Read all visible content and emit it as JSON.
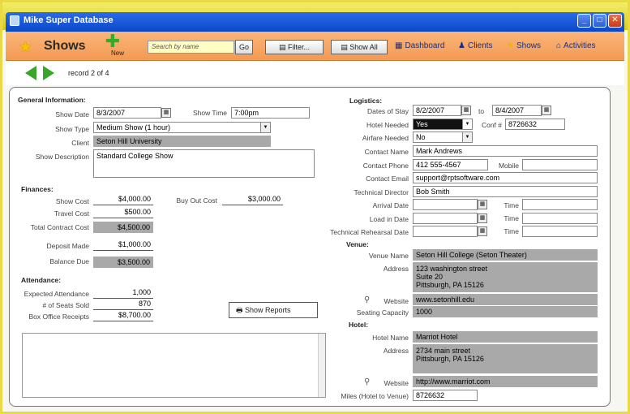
{
  "window": {
    "title": "Mike Super Database",
    "min": "_",
    "max": "□",
    "close": "✕"
  },
  "toolbar": {
    "title": "Shows",
    "new_label": "New",
    "search_placeholder": "Search by name",
    "go_label": "Go",
    "filter_label": "Filter...",
    "show_all_label": "Show All",
    "nav": [
      {
        "label": "Dashboard",
        "icon": "dashboard-icon"
      },
      {
        "label": "Clients",
        "icon": "clients-icon"
      },
      {
        "label": "Shows",
        "icon": "star-icon"
      },
      {
        "label": "Activities",
        "icon": "activities-icon"
      }
    ]
  },
  "record": {
    "text": "record 2 of 4"
  },
  "general": {
    "heading": "General Information:",
    "show_date_label": "Show Date",
    "show_date": "8/3/2007",
    "show_time_label": "Show Time",
    "show_time": "7:00pm",
    "show_type_label": "Show Type",
    "show_type": "Medium Show (1 hour)",
    "client_label": "Client",
    "client": "Seton Hill University",
    "description_label": "Show Description",
    "description": "Standard College Show"
  },
  "finances": {
    "heading": "Finances:",
    "show_cost_label": "Show Cost",
    "show_cost": "$4,000.00",
    "buyout_label": "Buy Out Cost",
    "buyout": "$3,000.00",
    "travel_label": "Travel Cost",
    "travel": "$500.00",
    "total_label": "Total Contract Cost",
    "total": "$4,500.00",
    "deposit_label": "Deposit Made",
    "deposit": "$1,000.00",
    "balance_label": "Balance Due",
    "balance": "$3,500.00"
  },
  "attendance": {
    "heading": "Attendance:",
    "expected_label": "Expected Attendance",
    "expected": "1,000",
    "seats_label": "# of Seats Sold",
    "seats": "870",
    "receipts_label": "Box Office Receipts",
    "receipts": "$8,700.00"
  },
  "show_reports_label": "Show Reports",
  "logistics": {
    "heading": "Logistics:",
    "stay_label": "Dates of Stay",
    "stay_from": "8/2/2007",
    "to_label": "to",
    "stay_to": "8/4/2007",
    "hotel_needed_label": "Hotel Needed",
    "hotel_needed": "Yes",
    "conf_label": "Conf #",
    "conf": "8726632",
    "airfare_label": "Airfare Needed",
    "airfare": "No",
    "contact_name_label": "Contact Name",
    "contact_name": "Mark Andrews",
    "contact_phone_label": "Contact Phone",
    "contact_phone": "412 555-4567",
    "mobile_label": "Mobile",
    "mobile": "",
    "contact_email_label": "Contact Email",
    "contact_email": "support@rptsoftware.com",
    "tech_director_label": "Technical Director",
    "tech_director": "Bob Smith",
    "arrival_label": "Arrival Date",
    "load_label": "Load in Date",
    "rehearsal_label": "Technical Rehearsal Date",
    "time_label": "Time"
  },
  "venue": {
    "heading": "Venue:",
    "name_label": "Venue Name",
    "name": "Seton Hill College (Seton Theater)",
    "address_label": "Address",
    "address_lines": [
      "123 washington street",
      "Suite 20",
      "Pittsburgh, PA 15126"
    ],
    "website_label": "Website",
    "website": "www.setonhill.edu",
    "capacity_label": "Seating Capacity",
    "capacity": "1000"
  },
  "hotel": {
    "heading": "Hotel:",
    "name_label": "Hotel Name",
    "name": "Marriot Hotel",
    "address_label": "Address",
    "address_lines": [
      "2734 main street",
      "Pittsburgh, PA 15126"
    ],
    "website_label": "Website",
    "website": "http://www.marriot.com",
    "miles_label": "Miles (Hotel to Venue)",
    "miles": "8726632"
  }
}
